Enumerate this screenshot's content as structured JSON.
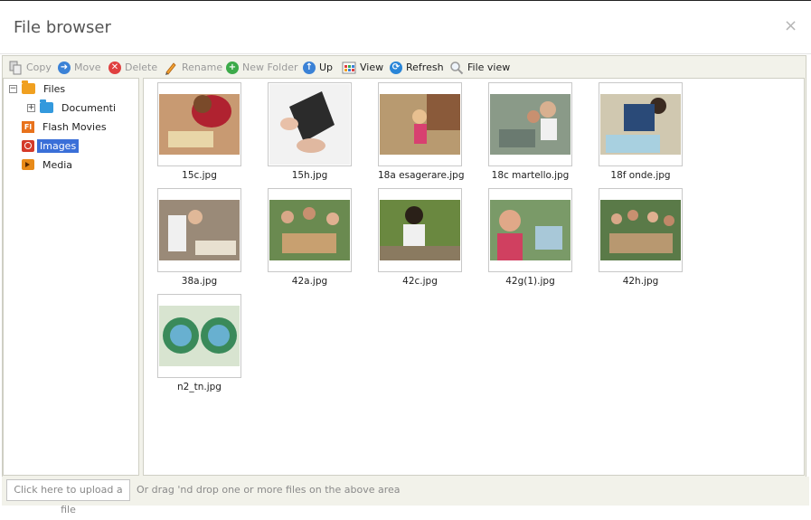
{
  "window": {
    "title": "File browser",
    "close_symbol": "×"
  },
  "toolbar": {
    "copy": "Copy",
    "move": "Move",
    "delete": "Delete",
    "rename": "Rename",
    "new_folder": "New Folder",
    "up": "Up",
    "view": "View",
    "refresh": "Refresh",
    "file_view": "File view"
  },
  "tree": {
    "root": "Files",
    "items": [
      "Documenti",
      "Flash Movies",
      "Images",
      "Media"
    ],
    "selected": "Images",
    "expanded_symbol": "−",
    "collapsed_symbol": "+"
  },
  "files": [
    {
      "name": "15c.jpg"
    },
    {
      "name": "15h.jpg"
    },
    {
      "name": "18a esagerare.jpg"
    },
    {
      "name": "18c martello.jpg"
    },
    {
      "name": "18f onde.jpg"
    },
    {
      "name": "38a.jpg"
    },
    {
      "name": "42a.jpg"
    },
    {
      "name": "42c.jpg"
    },
    {
      "name": "42g(1).jpg"
    },
    {
      "name": "42h.jpg"
    },
    {
      "name": "n2_tn.jpg"
    }
  ],
  "footer": {
    "upload_label": "Click here to upload a file",
    "drop_hint": "Or drag 'nd drop one or more files on the above area"
  }
}
